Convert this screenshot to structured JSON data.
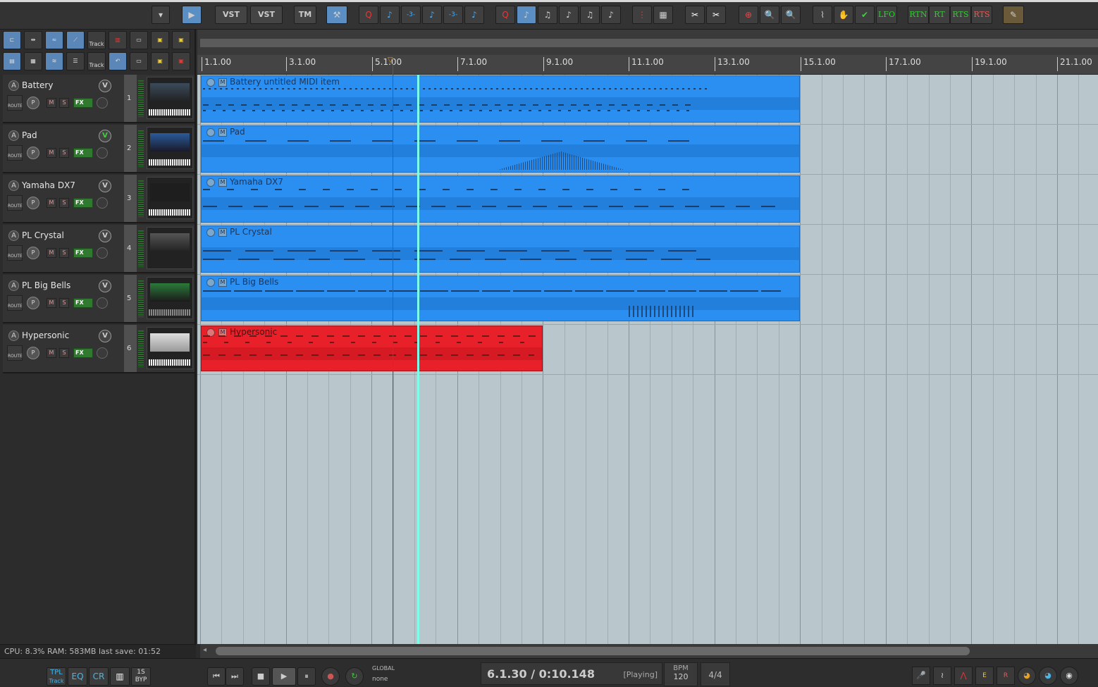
{
  "toolbar": {
    "vst1": "VST",
    "vst2": "VST",
    "tm": "TM",
    "lfo": "LFO",
    "rtn": "RTN",
    "rt": "RT",
    "rts1": "RTS",
    "rts2": "RTS"
  },
  "leftpanel": {
    "track_btn_1": "Track",
    "track_btn_2": "Track"
  },
  "tracks": [
    {
      "name": "Battery",
      "number": "1",
      "arm": "A",
      "vbtn": "V",
      "route": "ROUTE",
      "knob": "P",
      "mute": "M",
      "solo": "S",
      "fx": "FX"
    },
    {
      "name": "Pad",
      "number": "2",
      "arm": "A",
      "vbtn": "V",
      "route": "ROUTE",
      "knob": "P",
      "mute": "M",
      "solo": "S",
      "fx": "FX"
    },
    {
      "name": "Yamaha DX7",
      "number": "3",
      "arm": "A",
      "vbtn": "V",
      "route": "ROUTE",
      "knob": "P",
      "mute": "M",
      "solo": "S",
      "fx": "FX"
    },
    {
      "name": "PL Crystal",
      "number": "4",
      "arm": "A",
      "vbtn": "V",
      "route": "ROUTE",
      "knob": "P",
      "mute": "M",
      "solo": "S",
      "fx": "FX"
    },
    {
      "name": "PL Big Bells",
      "number": "5",
      "arm": "A",
      "vbtn": "V",
      "route": "ROUTE",
      "knob": "P",
      "mute": "M",
      "solo": "S",
      "fx": "FX"
    },
    {
      "name": "Hypersonic",
      "number": "6",
      "arm": "A",
      "vbtn": "V",
      "route": "ROUTE",
      "knob": "P",
      "mute": "M",
      "solo": "S",
      "fx": "FX"
    }
  ],
  "items": [
    {
      "name": "Battery untitled MIDI item",
      "m": "M"
    },
    {
      "name": "Pad",
      "m": "M"
    },
    {
      "name": "Yamaha DX7",
      "m": "M"
    },
    {
      "name": "PL Crystal",
      "m": "M"
    },
    {
      "name": "PL Big Bells",
      "m": "M"
    },
    {
      "name": "Hypersonic",
      "m": "M"
    }
  ],
  "ruler": [
    "1.1.00",
    "3.1.00",
    "5.1.00",
    "7.1.00",
    "9.1.00",
    "11.1.00",
    "13.1.00",
    "15.1.00",
    "17.1.00",
    "19.1.00",
    "21.1.00"
  ],
  "status": "CPU: 8.3%  RAM: 583MB  last save: 01:52",
  "bottom": {
    "tpl_top": "TPL",
    "tpl_bottom": "Track",
    "eq": "EQ",
    "cr": "CR",
    "byp_top": "1S",
    "byp_bottom": "BYP",
    "global": "GLOBAL",
    "none": "none",
    "time": "6.1.30 / 0:10.148",
    "state": "[Playing]",
    "bpm_label": "BPM",
    "bpm": "120",
    "signature": "4/4"
  },
  "colors": {
    "item_blue": "#2a8ff0",
    "item_red": "#e8202a",
    "playhead": "#7fffe8",
    "edit_cursor": "#d8261c"
  }
}
